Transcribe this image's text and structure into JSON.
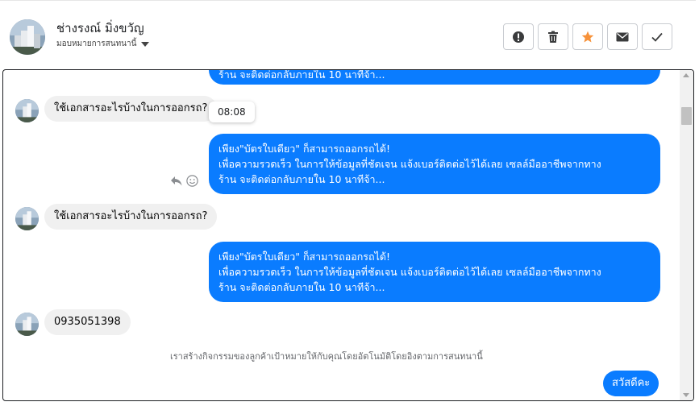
{
  "header": {
    "name": "ช่างรงณ์ มิ่งขวัญ",
    "assign_label": "มอบหมายการสนทนานี้",
    "actions": [
      {
        "icon": "alert-icon",
        "label": "spam"
      },
      {
        "icon": "trash-icon",
        "label": "delete"
      },
      {
        "icon": "star-icon",
        "label": "star"
      },
      {
        "icon": "mail-icon",
        "label": "mark-unread"
      },
      {
        "icon": "check-icon",
        "label": "done"
      }
    ]
  },
  "colors": {
    "outgoing": "#0a7cff",
    "incoming": "#f0f0f0",
    "star": "#f7923a",
    "icon": "#3a3b3c"
  },
  "chat": {
    "messages": [
      {
        "direction": "out",
        "lines": [
          "ร้าน จะติดต่อกลับภายใน 10 นาทีจ้า..."
        ]
      },
      {
        "direction": "in",
        "text": "ใช้เอกสารอะไรบ้างในการออกรถ?"
      },
      {
        "direction": "tooltip",
        "text": "08:08"
      },
      {
        "direction": "out",
        "lines": [
          "เพียง\"บัตรใบเดียว\" ก็สามารถออกรถได้!",
          "เพื่อความรวดเร็ว ในการให้ข้อมูลที่ชัดเจน แจ้งเบอร์ติดต่อไว้ได้เลย เซลล์มืออาชีพจากทาง",
          "ร้าน จะติดต่อกลับภายใน 10 นาทีจ้า..."
        ]
      },
      {
        "direction": "in",
        "text": "ใช้เอกสารอะไรบ้างในการออกรถ?"
      },
      {
        "direction": "out",
        "lines": [
          "เพียง\"บัตรใบเดียว\" ก็สามารถออกรถได้!",
          "เพื่อความรวดเร็ว ในการให้ข้อมูลที่ชัดเจน แจ้งเบอร์ติดต่อไว้ได้เลย เซลล์มืออาชีพจากทาง",
          "ร้าน จะติดต่อกลับภายใน 10 นาทีจ้า..."
        ]
      },
      {
        "direction": "in",
        "text": "0935051398"
      },
      {
        "direction": "note",
        "text": "เราสร้างกิจกรรมของลูกค้าเป้าหมายให้กับคุณโดยอัตโนมัติโดยอิงตามการสนทนานี้"
      },
      {
        "direction": "out",
        "text": "สวัสดีคะ"
      }
    ]
  }
}
